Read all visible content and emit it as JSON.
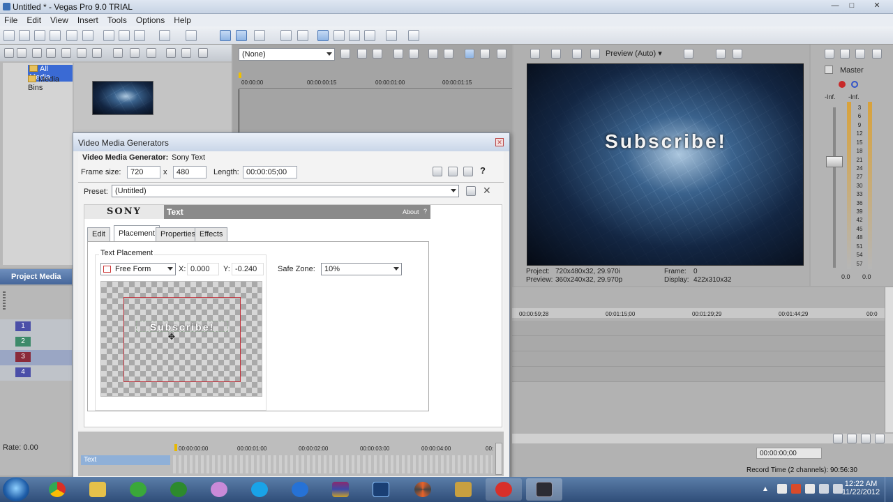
{
  "window": {
    "title": "Untitled * - Vegas Pro 9.0 TRIAL"
  },
  "menu": [
    "File",
    "Edit",
    "View",
    "Insert",
    "Tools",
    "Options",
    "Help"
  ],
  "explorer": {
    "tree": [
      {
        "label": "All Media",
        "selected": true
      },
      {
        "label": "Media Bins",
        "selected": false
      }
    ],
    "tab_label": "Project Media"
  },
  "trimmer": {
    "preset": "(None)",
    "ruler": [
      "00:00:00",
      "00:00:00:15",
      "00:00:01:00",
      "00:00:01:15"
    ]
  },
  "preview": {
    "mode": "Preview (Auto)",
    "overlay_text": "Subscribe!",
    "project_label": "Project:",
    "project_value": "720x480x32, 29.970i",
    "preview_label": "Preview:",
    "preview_value": "360x240x32, 29.970p",
    "frame_label": "Frame:",
    "frame_value": "0",
    "display_label": "Display:",
    "display_value": "422x310x32"
  },
  "master": {
    "label": "Master",
    "scale": [
      "3",
      "6",
      "9",
      "12",
      "15",
      "18",
      "21",
      "24",
      "27",
      "30",
      "33",
      "36",
      "39",
      "42",
      "45",
      "48",
      "51",
      "54",
      "57"
    ],
    "top_left": "-Inf.",
    "top_right": "-Inf.",
    "bottom_left": "0.0",
    "bottom_right": "0.0"
  },
  "dialog": {
    "title": "Video Media Generators",
    "generator_label": "Video Media Generator:",
    "generator_value": "Sony Text",
    "frame_size_label": "Frame size:",
    "frame_w": "720",
    "frame_x": "x",
    "frame_h": "480",
    "length_label": "Length:",
    "length_value": "00:00:05;00",
    "preset_label": "Preset:",
    "preset_value": "(Untitled)",
    "brand": "SONY",
    "plugin": "Text",
    "about": "About",
    "tabs": [
      "Edit",
      "Placement",
      "Properties",
      "Effects"
    ],
    "active_tab": "Placement",
    "placement_group": "Text Placement",
    "placement_mode": "Free Form",
    "x_label": "X:",
    "x_value": "0.000",
    "y_label": "Y:",
    "y_value": "-0.240",
    "safe_label": "Safe Zone:",
    "safe_value": "10%",
    "canvas_text": "Subscribe!",
    "timeline_ruler": [
      "00:00:00:00",
      "00:00:01:00",
      "00:00:02:00",
      "00:00:03:00",
      "00:00:04:00",
      "00:"
    ],
    "track_label": "Text"
  },
  "timeline": {
    "tracks": [
      {
        "num": "1",
        "color": "#4b4fa8"
      },
      {
        "num": "2",
        "color": "#3e8a6a"
      },
      {
        "num": "3",
        "color": "#8a2a3a"
      },
      {
        "num": "4",
        "color": "#4b4fa8"
      }
    ],
    "ruler": [
      "00:00:59;28",
      "00:01:15;00",
      "00:01:29;29",
      "00:01:44;29",
      "00:0"
    ],
    "rate": "Rate: 0.00",
    "time": "00:00:00;00",
    "record_time": "Record Time (2 channels): 90:56:30"
  },
  "taskbar": {
    "time": "12:22 AM",
    "date": "11/22/2012",
    "apps": [
      "start",
      "chrome",
      "explorer",
      "lime",
      "utorrent",
      "messenger",
      "skype",
      "flash",
      "winrar",
      "photoshop",
      "pinwheel",
      "hypercam",
      "download",
      "vegas"
    ]
  }
}
